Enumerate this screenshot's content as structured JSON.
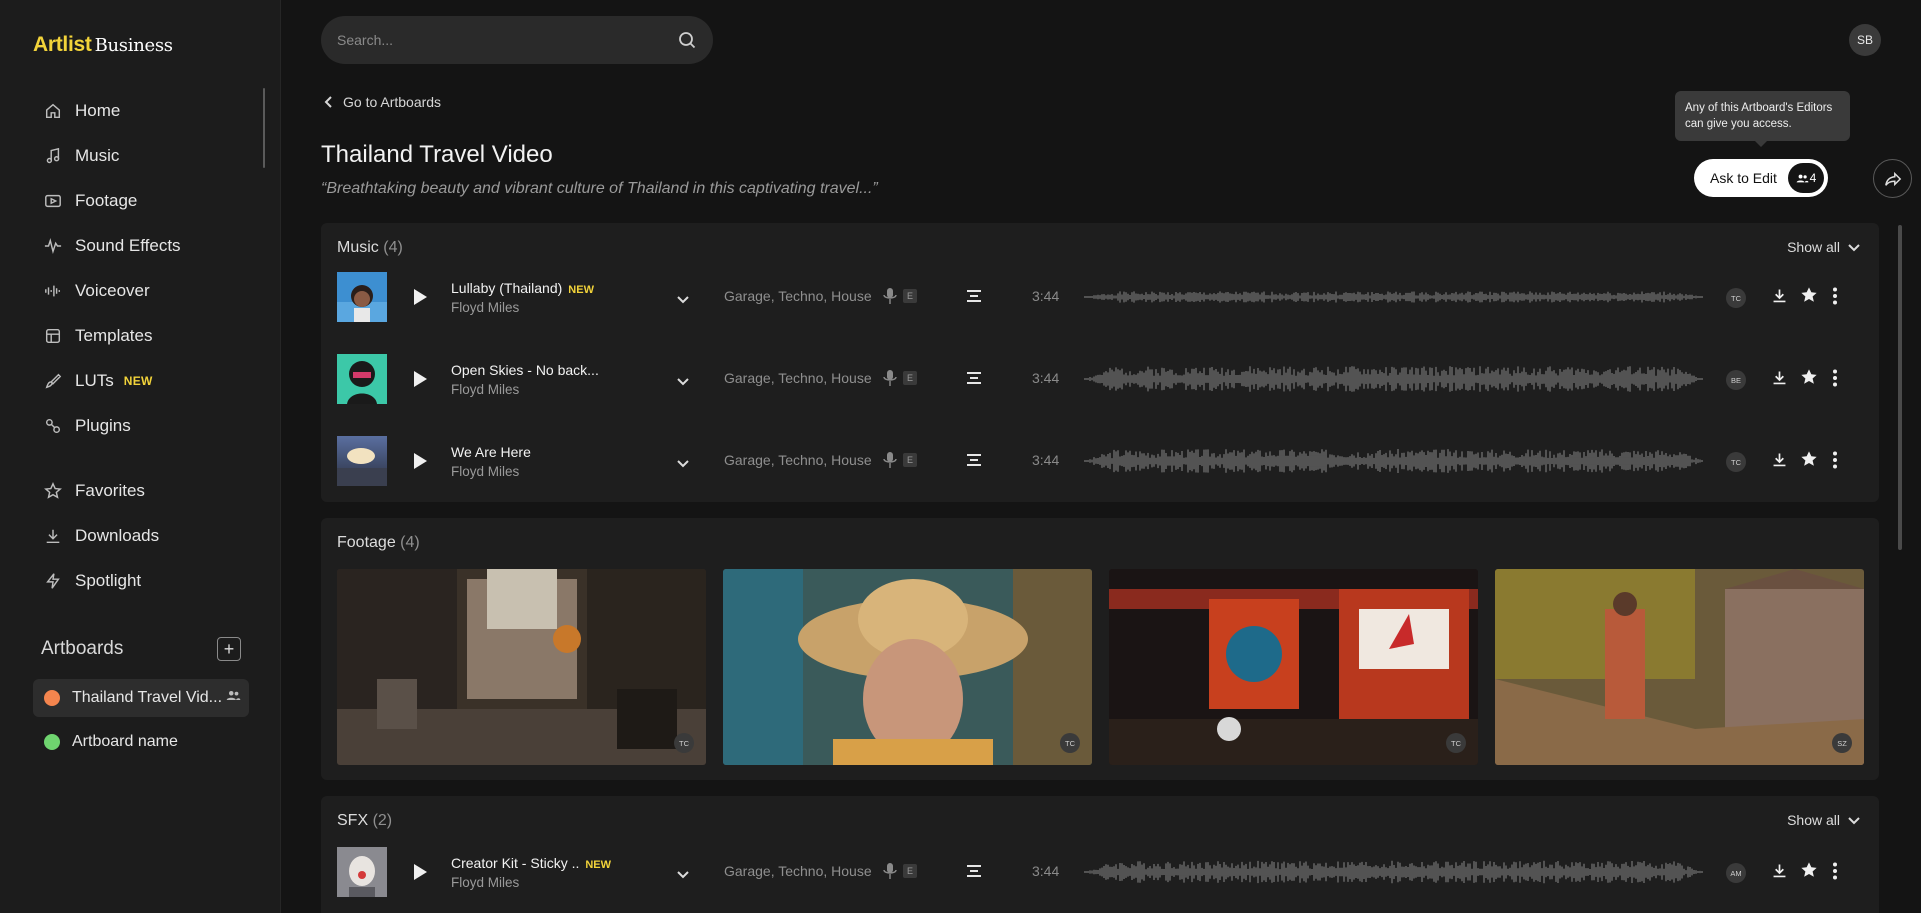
{
  "brand": {
    "name": "Artlist",
    "suffix": "Business"
  },
  "sidebar": {
    "items": [
      {
        "label": "Home",
        "icon": "home-icon"
      },
      {
        "label": "Music",
        "icon": "music-note-icon"
      },
      {
        "label": "Footage",
        "icon": "play-rect-icon"
      },
      {
        "label": "Sound Effects",
        "icon": "waveform-icon"
      },
      {
        "label": "Voiceover",
        "icon": "equalizer-icon"
      },
      {
        "label": "Templates",
        "icon": "template-icon"
      },
      {
        "label": "LUTs",
        "icon": "brush-icon",
        "badge": "NEW"
      },
      {
        "label": "Plugins",
        "icon": "plugin-icon"
      }
    ],
    "secondary": [
      {
        "label": "Favorites",
        "icon": "star-outline-icon"
      },
      {
        "label": "Downloads",
        "icon": "download-icon"
      },
      {
        "label": "Spotlight",
        "icon": "bolt-icon"
      }
    ],
    "artboards_title": "Artboards",
    "artboards": [
      {
        "label": "Thailand Travel Vid...",
        "color": "#f4854e",
        "shared": true
      },
      {
        "label": "Artboard name",
        "color": "#6fd46f",
        "shared": false
      }
    ]
  },
  "search": {
    "placeholder": "Search..."
  },
  "user": {
    "initials": "SB"
  },
  "back_link": "Go to Artboards",
  "artboard": {
    "title": "Thailand Travel Video",
    "description": "“Breathtaking beauty and vibrant culture of Thailand in this captivating travel...”"
  },
  "tooltip": "Any of this Artboard's Editors can give you access.",
  "ask_edit": {
    "label": "Ask to Edit",
    "count": "4"
  },
  "music": {
    "title": "Music",
    "count": "(4)",
    "show_all": "Show all",
    "tracks": [
      {
        "name": "Lullaby (Thailand)",
        "badge": "NEW",
        "artist": "Floyd Miles",
        "genres": "Garage, Techno, House",
        "e": "E",
        "duration": "3:44",
        "creator": "TC"
      },
      {
        "name": "Open Skies - No back...",
        "badge": "",
        "artist": "Floyd Miles",
        "genres": "Garage, Techno, House",
        "e": "E",
        "duration": "3:44",
        "creator": "BE"
      },
      {
        "name": "We Are Here",
        "badge": "",
        "artist": "Floyd Miles",
        "genres": "Garage, Techno, House",
        "e": "E",
        "duration": "3:44",
        "creator": "TC"
      }
    ]
  },
  "footage": {
    "title": "Footage",
    "count": "(4)",
    "clips": [
      {
        "creator": "TC"
      },
      {
        "creator": "TC"
      },
      {
        "creator": "TC"
      },
      {
        "creator": "SZ"
      }
    ]
  },
  "sfx": {
    "title": "SFX",
    "count": "(2)",
    "show_all": "Show all",
    "tracks": [
      {
        "name": "Creator Kit - Sticky ..",
        "badge": "NEW",
        "artist": "Floyd Miles",
        "genres": "Garage, Techno, House",
        "e": "E",
        "duration": "3:44",
        "creator": "AM"
      }
    ]
  },
  "colors": {
    "accent": "#f2d33a",
    "background": "#141414",
    "sidebar": "#1c1c1c",
    "panel": "#1e1e1e"
  }
}
